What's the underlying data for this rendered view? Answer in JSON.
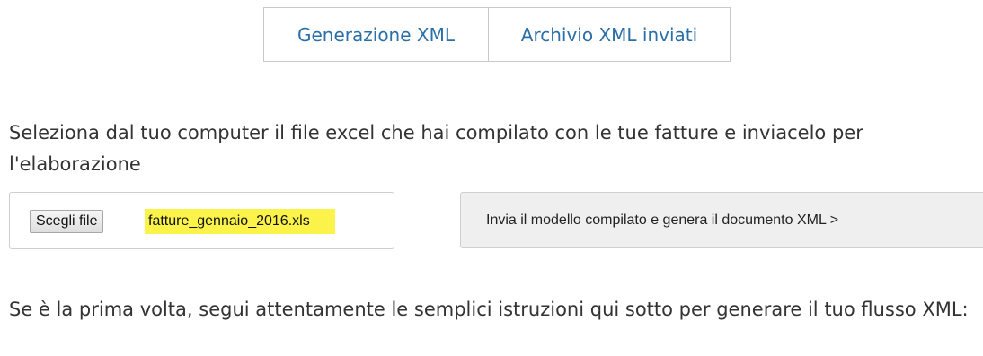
{
  "tabs": [
    {
      "label": "Generazione XML"
    },
    {
      "label": "Archivio XML inviati"
    }
  ],
  "intro": {
    "text": "Seleziona dal tuo computer il file excel che hai compilato con le tue fatture e inviacelo per l'elaborazione"
  },
  "file_input": {
    "button_label": "Scegli file",
    "file_name": "fatture_gennaio_2016.xls",
    "highlight_color": "#fbf24a"
  },
  "submit": {
    "label": "Invia il modello compilato e genera il documento XML >"
  },
  "instructions": {
    "text": "Se è la prima volta, segui attentamente le semplici istruzioni qui sotto per generare il tuo flusso XML:"
  },
  "colors": {
    "link": "#2a6fa8",
    "text": "#333333"
  }
}
